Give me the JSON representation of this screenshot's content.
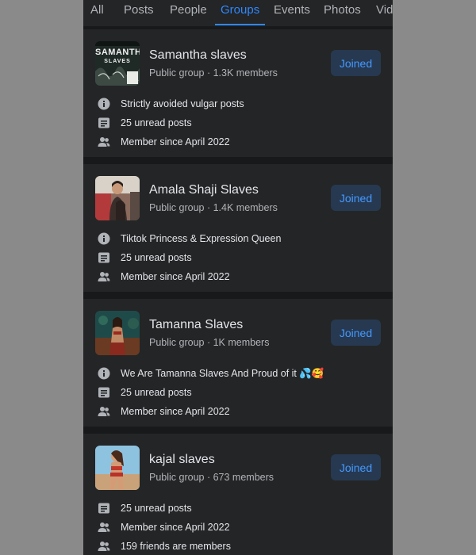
{
  "tabs": [
    "All",
    "Posts",
    "People",
    "Groups",
    "Events",
    "Photos",
    "Vide"
  ],
  "active_tab": "Groups",
  "groups": [
    {
      "name": "Samantha slaves",
      "meta": "Public group · 1.3K members",
      "button": "Joined",
      "thumb_text": "SAMANTHA",
      "thumb_subtext": "SLAVES",
      "rows": [
        {
          "icon": "info-icon",
          "text": "Strictly avoided vulgar posts"
        },
        {
          "icon": "posts-icon",
          "text": "25 unread posts"
        },
        {
          "icon": "members-icon",
          "text": "Member since April 2022"
        }
      ]
    },
    {
      "name": "Amala Shaji Slaves",
      "meta": "Public group · 1.4K members",
      "button": "Joined",
      "rows": [
        {
          "icon": "info-icon",
          "text": "Tiktok Princess & Expression Queen"
        },
        {
          "icon": "posts-icon",
          "text": "25 unread posts"
        },
        {
          "icon": "members-icon",
          "text": "Member since April 2022"
        }
      ]
    },
    {
      "name": "Tamanna Slaves",
      "meta": "Public group · 1K members",
      "button": "Joined",
      "rows": [
        {
          "icon": "info-icon",
          "text": "We Are Tamanna Slaves And Proud of it 💦🥰"
        },
        {
          "icon": "posts-icon",
          "text": "25 unread posts"
        },
        {
          "icon": "members-icon",
          "text": "Member since April 2022"
        }
      ]
    },
    {
      "name": "kajal slaves",
      "meta": "Public group · 673 members",
      "button": "Joined",
      "rows": [
        {
          "icon": "posts-icon",
          "text": "25 unread posts"
        },
        {
          "icon": "members-icon",
          "text": "Member since April 2022"
        },
        {
          "icon": "members-icon",
          "text": "159 friends are members"
        }
      ]
    }
  ],
  "colors": {
    "background": "#18191a",
    "card": "#242526",
    "accent": "#2d88ff",
    "button_bg": "#263951",
    "primary_text": "#e4e6eb",
    "secondary_text": "#b0b3b8"
  }
}
